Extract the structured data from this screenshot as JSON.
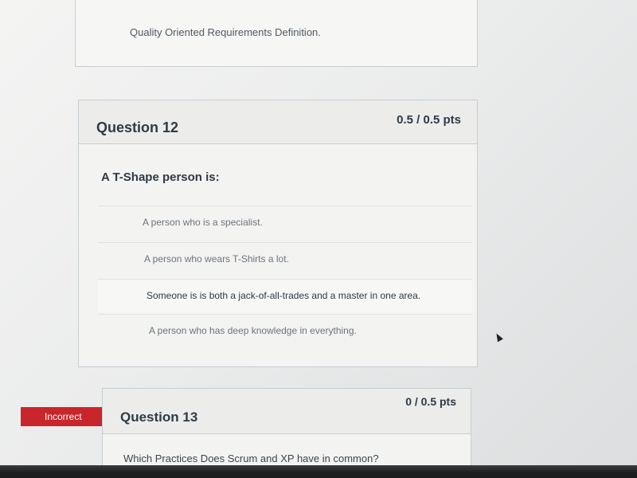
{
  "previous_question": {
    "answer_text": "Quality Oriented Requirements Definition."
  },
  "question12": {
    "title": "Question 12",
    "points": "0.5 / 0.5 pts",
    "prompt": "A T-Shape person is:",
    "answers": [
      {
        "text": "A person who is a specialist.",
        "selected": false
      },
      {
        "text": "A person who wears T-Shirts a lot.",
        "selected": false
      },
      {
        "text": "Someone is is both a jack-of-all-trades and a master in one area.",
        "selected": true
      },
      {
        "text": "A person who has deep knowledge in everything.",
        "selected": false
      }
    ]
  },
  "question13": {
    "badge": "Incorrect",
    "title": "Question 13",
    "points": "0 / 0.5 pts",
    "prompt": "Which Practices Does Scrum and XP have in common?"
  },
  "colors": {
    "incorrect_badge": "#c9262c",
    "text_primary": "#2d3b45",
    "border": "#c7cdd1"
  }
}
